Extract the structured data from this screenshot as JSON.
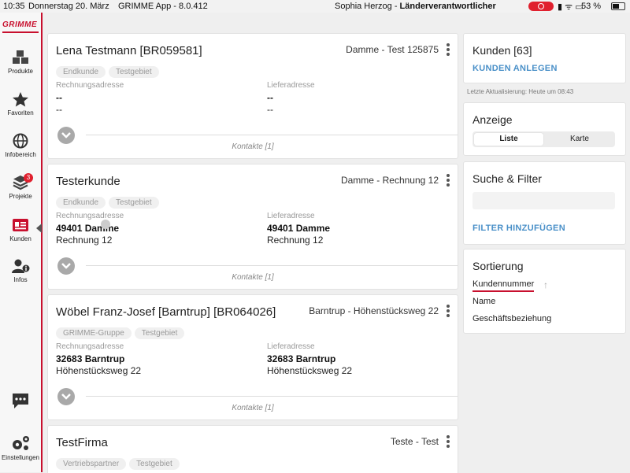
{
  "status": {
    "time": "10:35",
    "date": "Donnerstag 20. März",
    "app": "GRIMME App - 8.0.412",
    "user_name": "Sophia Herzog - ",
    "user_role": "Länderverantwortlicher",
    "battery": "53 %"
  },
  "sidebar": {
    "logo": "GRIMME",
    "items": [
      {
        "label": "Produkte",
        "icon": "cubes-icon"
      },
      {
        "label": "Favoriten",
        "icon": "star-icon"
      },
      {
        "label": "Infobereich",
        "icon": "globe-icon"
      },
      {
        "label": "Projekte",
        "icon": "layers-icon",
        "badge": "3"
      },
      {
        "label": "Kunden",
        "icon": "contact-card-icon",
        "active": true
      },
      {
        "label": "Infos",
        "icon": "user-info-icon"
      },
      {
        "label": "",
        "icon": "chat-icon"
      },
      {
        "label": "Einstellungen",
        "icon": "gears-icon"
      }
    ]
  },
  "customers": [
    {
      "name": "Lena Testmann [BR059581]",
      "location": "Damme - Test 125875",
      "tags": [
        "Endkunde",
        "Testgebiet"
      ],
      "billing_label": "Rechnungsadresse",
      "billing_line1": "--",
      "billing_line2": "--",
      "delivery_label": "Lieferadresse",
      "delivery_line1": "--",
      "delivery_line2": "--",
      "contacts": "Kontakte [1]"
    },
    {
      "name": "Testerkunde",
      "location": "Damme - Rechnung 12",
      "tags": [
        "Endkunde",
        "Testgebiet"
      ],
      "billing_label": "Rechnungsadresse",
      "billing_line1": "49401 Damme",
      "billing_line2": "Rechnung 12",
      "delivery_label": "Lieferadresse",
      "delivery_line1": "49401 Damme",
      "delivery_line2": "Rechnung 12",
      "contacts": "Kontakte [1]"
    },
    {
      "name": "Wöbel Franz-Josef [Barntrup] [BR064026]",
      "location": "Barntrup - Höhenstücksweg 22",
      "tags": [
        "GRIMME-Gruppe",
        "Testgebiet"
      ],
      "billing_label": "Rechnungsadresse",
      "billing_line1": "32683 Barntrup",
      "billing_line2": "Höhenstücksweg 22",
      "delivery_label": "Lieferadresse",
      "delivery_line1": "32683 Barntrup",
      "delivery_line2": "Höhenstücksweg 22",
      "contacts": "Kontakte [1]"
    },
    {
      "name": "TestFirma",
      "location": "Teste - Test",
      "tags": [
        "Vertriebspartner",
        "Testgebiet"
      ]
    }
  ],
  "right": {
    "customers_title": "Kunden [63]",
    "add_customer": "KUNDEN ANLEGEN",
    "last_update": "Letzte Aktualisierung: Heute um 08:43",
    "view_title": "Anzeige",
    "view_list": "Liste",
    "view_map": "Karte",
    "search_title": "Suche & Filter",
    "search_value": "",
    "add_filter": "FILTER HINZUFÜGEN",
    "sort_title": "Sortierung",
    "sort_options": [
      "Kundennummer",
      "Name",
      "Geschäftsbeziehung"
    ],
    "sort_arrow": "↑"
  },
  "colors": {
    "brand_red": "#c8102e",
    "link_blue": "#4a90c8"
  }
}
